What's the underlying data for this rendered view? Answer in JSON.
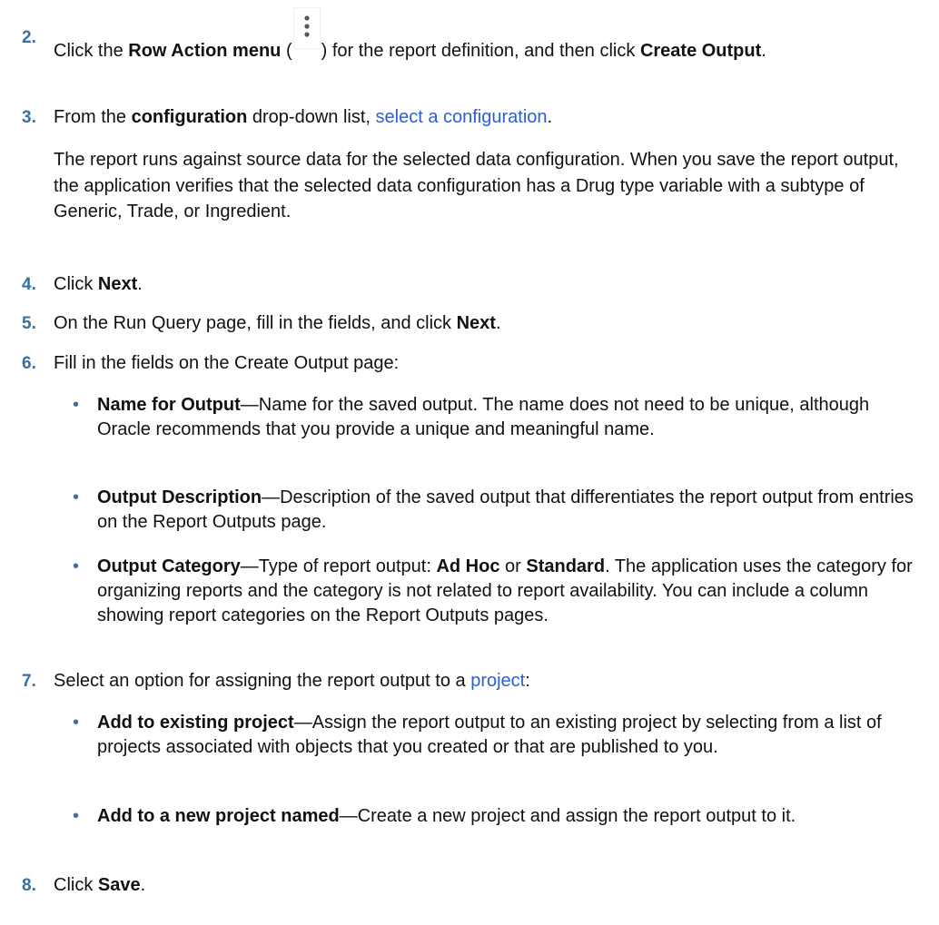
{
  "steps": [
    {
      "number": "2.",
      "t1": "Click the ",
      "b1": "Row Action menu",
      "t2": " (",
      "icon": "kebab-menu-icon",
      "t3": ") for the report definition, and then click ",
      "b2": "Create Output",
      "t4": "."
    },
    {
      "number": "3.",
      "t1": "From the ",
      "b1": "configuration",
      "t2": " drop-down list, ",
      "link": "select a configuration",
      "t3": ".",
      "paragraph": "The report runs against source data for the selected data configuration. When you save the report output, the application verifies that the selected data configuration has a Drug type variable with a subtype of Generic, Trade, or Ingredient."
    },
    {
      "number": "4.",
      "t1": "Click ",
      "b1": "Next",
      "t2": "."
    },
    {
      "number": "5.",
      "t1": "On the Run Query page, fill in the fields, and click ",
      "b1": "Next",
      "t2": "."
    },
    {
      "number": "6.",
      "t1": "Fill in the fields on the Create Output page:",
      "bullets": [
        {
          "bold": "Name for Output",
          "text": "—Name for the saved output. The name does not need to be unique, although Oracle recommends that you provide a unique and meaningful name."
        },
        {
          "bold": "Output Description",
          "text": "—Description of the saved output that differentiates the report output from entries on the Report Outputs page."
        },
        {
          "bold": "Output Category",
          "t1": "—Type of report output: ",
          "b2": "Ad Hoc",
          "t2": " or ",
          "b3": "Standard",
          "t3": ". The application uses the category for organizing reports and the category is not related to report availability. You can include a column showing report categories on the Report Outputs pages."
        }
      ]
    },
    {
      "number": "7.",
      "t1": "Select an option for assigning the report output to a ",
      "link": "project",
      "t2": ":",
      "bullets": [
        {
          "bold": "Add to existing project",
          "text": "—Assign the report output to an existing project by selecting from a list of projects associated with objects that you created or that are published to you."
        },
        {
          "bold": "Add to a new project named",
          "text": "—Create a new project and assign the report output to it."
        }
      ]
    },
    {
      "number": "8.",
      "t1": "Click ",
      "b1": "Save",
      "t2": "."
    }
  ],
  "colors": {
    "step_number": "#3a6fa5",
    "link": "#2b5fd3",
    "text": "#111111"
  }
}
